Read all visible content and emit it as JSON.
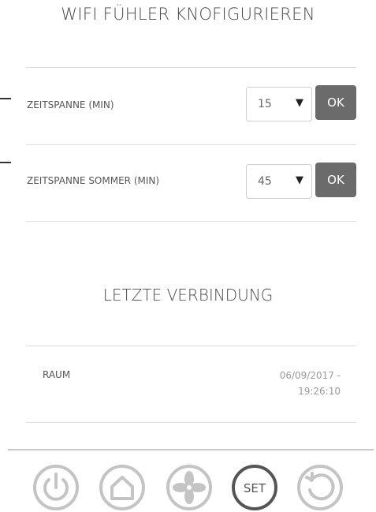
{
  "page": {
    "title": "WIFI FÜHLER KNOFIGURIEREN"
  },
  "settings": [
    {
      "label": "ZEITSPANNE (MIN)",
      "value": "15",
      "ok_label": "OK"
    },
    {
      "label": "ZEITSPANNE SOMMER (MIN)",
      "value": "45",
      "ok_label": "OK"
    }
  ],
  "last_connection": {
    "title": "LETZTE VERBINDUNG",
    "room_label": "RAUM",
    "date": "06/09/2017 -",
    "time": "19:26:10"
  },
  "nav": {
    "set_label": "SET",
    "icons": [
      "power-icon",
      "home-icon",
      "fan-icon",
      "set-icon",
      "refresh-icon"
    ]
  },
  "colors": {
    "button_bg": "#6b6b6b",
    "icon_inactive": "#c4c4c4",
    "icon_active": "#555555"
  }
}
